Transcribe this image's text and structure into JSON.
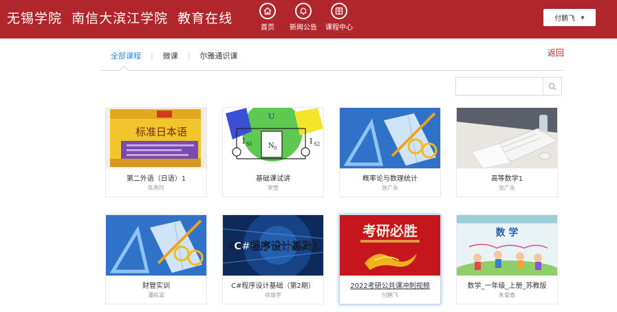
{
  "header": {
    "brand": "无锡学院  南信大滨江学院  教育在线",
    "nav": [
      {
        "label": "首页",
        "icon": "home-icon"
      },
      {
        "label": "新闻公告",
        "icon": "bell-icon"
      },
      {
        "label": "课程中心",
        "icon": "book-icon"
      }
    ],
    "user": {
      "name": "付鹏飞"
    }
  },
  "tabs": {
    "items": [
      {
        "label": "全部课程"
      },
      {
        "label": "微课"
      },
      {
        "label": "尔雅通识课"
      }
    ],
    "active_index": 0,
    "back": "返回"
  },
  "search": {
    "value": "",
    "placeholder": ""
  },
  "courses": [
    {
      "title": "第二外语（日语）1",
      "teacher": "陈燕玲",
      "cover": "japanese-textbook-cover",
      "book_title": "标准日本语"
    },
    {
      "title": "基础课试讲",
      "teacher": "宋莹",
      "cover": "circuit-diagram-cover",
      "labels": [
        "U",
        "I",
        "S1",
        "N",
        "0",
        "I",
        "S2"
      ]
    },
    {
      "title": "概率论与数理统计",
      "teacher": "张广永",
      "cover": "notebook-ruler-cover"
    },
    {
      "title": "高等数学1",
      "teacher": "张广永",
      "cover": "desk-laptop-cover"
    },
    {
      "title": "财管实训",
      "teacher": "潘栋梁",
      "cover": "notebook-ruler-cover"
    },
    {
      "title": "C#程序设计基础（第2期）",
      "teacher": "徐焕宇",
      "cover": "programming-cover",
      "banner": "《C#程序设计基础》"
    },
    {
      "title": "2022考研公共课冲刺视频",
      "teacher": "付鹏飞",
      "cover": "exam-cover",
      "banner": "考研必胜"
    },
    {
      "title": "数学_一年级_上册_苏教版",
      "teacher": "朱菊香",
      "cover": "math-textbook-cover",
      "banner": "数 学"
    }
  ]
}
